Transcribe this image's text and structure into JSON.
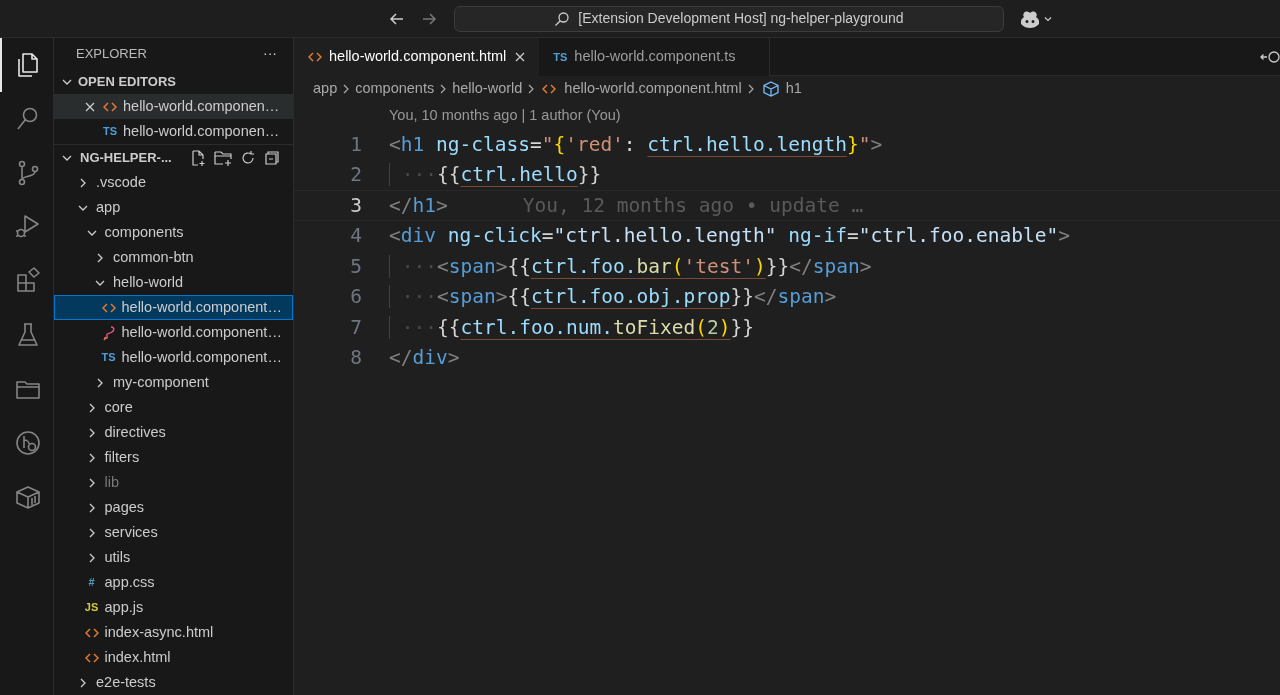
{
  "title_bar": {
    "search_text": "[Extension Development Host] ng-helper-playground"
  },
  "activity_bar": [
    {
      "kind": "files",
      "selected": true
    },
    {
      "kind": "search",
      "selected": false
    },
    {
      "kind": "source-control",
      "selected": false
    },
    {
      "kind": "run-debug",
      "selected": false
    },
    {
      "kind": "extensions",
      "selected": false
    },
    {
      "kind": "testing",
      "selected": false
    },
    {
      "kind": "folder",
      "selected": false
    },
    {
      "kind": "branch-search",
      "selected": false
    },
    {
      "kind": "package",
      "selected": false
    }
  ],
  "sidebar": {
    "title": "EXPLORER",
    "more": "···",
    "open_editors": {
      "title": "OPEN EDITORS",
      "expanded": true,
      "items": [
        {
          "kind": "html",
          "label": "hello-world.componen…",
          "selected": true
        },
        {
          "kind": "ts",
          "badge": "TS",
          "label": "hello-world.componen…",
          "selected": false
        }
      ]
    },
    "project": {
      "title": "NG-HELPER-...",
      "expanded": true,
      "items": [
        {
          "kind": "folder",
          "label": ".vscode",
          "expanded": false,
          "selected": false
        },
        {
          "kind": "folder",
          "label": "app",
          "expanded": true,
          "selected": false,
          "children": [
            {
              "kind": "folder",
              "label": "components",
              "expanded": true,
              "selected": false,
              "children": [
                {
                  "kind": "folder",
                  "label": "common-btn",
                  "expanded": false,
                  "selected": false
                },
                {
                  "kind": "folder",
                  "label": "hello-world",
                  "expanded": true,
                  "selected": false,
                  "children": [
                    {
                      "kind": "html",
                      "label": "hello-world.component…",
                      "selected": true
                    },
                    {
                      "kind": "style",
                      "label": "hello-world.component…",
                      "selected": false
                    },
                    {
                      "kind": "ts",
                      "badge": "TS",
                      "label": "hello-world.component…",
                      "selected": false
                    }
                  ]
                },
                {
                  "kind": "folder",
                  "label": "my-component",
                  "expanded": false,
                  "selected": false
                }
              ]
            },
            {
              "kind": "folder",
              "label": "core",
              "expanded": false,
              "selected": false
            },
            {
              "kind": "folder",
              "label": "directives",
              "expanded": false,
              "selected": false
            },
            {
              "kind": "folder",
              "label": "filters",
              "expanded": false,
              "selected": false
            },
            {
              "kind": "folder",
              "label": "lib",
              "expanded": false,
              "selected": false,
              "dimmed": true
            },
            {
              "kind": "folder",
              "label": "pages",
              "expanded": false,
              "selected": false
            },
            {
              "kind": "folder",
              "label": "services",
              "expanded": false,
              "selected": false
            },
            {
              "kind": "folder",
              "label": "utils",
              "expanded": false,
              "selected": false
            },
            {
              "kind": "css",
              "badge": "#",
              "label": "app.css",
              "selected": false
            },
            {
              "kind": "js",
              "badge": "JS",
              "label": "app.js",
              "selected": false
            },
            {
              "kind": "html",
              "label": "index-async.html",
              "selected": false
            },
            {
              "kind": "html",
              "label": "index.html",
              "selected": false
            }
          ]
        },
        {
          "kind": "folder",
          "label": "e2e-tests",
          "expanded": false,
          "selected": false
        }
      ]
    }
  },
  "tabs": [
    {
      "kind": "html",
      "label": "hello-world.component.html",
      "selected": true
    },
    {
      "kind": "ts",
      "badge": "TS",
      "label": "hello-world.component.ts",
      "selected": false
    }
  ],
  "breadcrumbs": [
    "app",
    "components",
    "hello-world",
    "hello-world.component.html",
    "h1"
  ],
  "codelens": "You, 10 months ago | 1 author (You)",
  "lines": [
    {
      "number": "1",
      "current": false,
      "tokens": [
        {
          "kind": "punct",
          "text": "<"
        },
        {
          "kind": "tag",
          "text": "h1"
        },
        {
          "kind": "attr",
          "text": " ng-class"
        },
        {
          "kind": "plain",
          "text": "="
        },
        {
          "kind": "str",
          "text": "\""
        },
        {
          "kind": "brace",
          "text": "{"
        },
        {
          "kind": "str",
          "text": "'red'"
        },
        {
          "kind": "plain",
          "text": ": "
        },
        {
          "kind": "var",
          "text": "ctrl.hello.length",
          "underline": true
        },
        {
          "kind": "brace",
          "text": "}"
        },
        {
          "kind": "str",
          "text": "\""
        },
        {
          "kind": "punct",
          "text": ">"
        }
      ]
    },
    {
      "number": "2",
      "current": false,
      "tokens": [
        {
          "kind": "ws",
          "text": "···"
        },
        {
          "kind": "plain",
          "text": "{{"
        },
        {
          "kind": "var",
          "text": "ctrl.hello",
          "underline": true
        },
        {
          "kind": "plain",
          "text": "}}"
        }
      ]
    },
    {
      "number": "3",
      "current": true,
      "blame": "You, 12 months ago • update …",
      "tokens": [
        {
          "kind": "punct",
          "text": "</"
        },
        {
          "kind": "tag",
          "text": "h1"
        },
        {
          "kind": "punct",
          "text": ">"
        }
      ]
    },
    {
      "number": "4",
      "current": false,
      "tokens": [
        {
          "kind": "punct",
          "text": "<"
        },
        {
          "kind": "tag",
          "text": "div"
        },
        {
          "kind": "attr",
          "text": " ng-click"
        },
        {
          "kind": "plain",
          "text": "="
        },
        {
          "kind": "value",
          "text": "\"ctrl.hello.length\""
        },
        {
          "kind": "attr",
          "text": " ng-if"
        },
        {
          "kind": "plain",
          "text": "="
        },
        {
          "kind": "value",
          "text": "\"ctrl.foo.enable\""
        },
        {
          "kind": "punct",
          "text": ">"
        }
      ]
    },
    {
      "number": "5",
      "current": false,
      "tokens": [
        {
          "kind": "ws",
          "text": "···"
        },
        {
          "kind": "punct",
          "text": "<"
        },
        {
          "kind": "tag",
          "text": "span"
        },
        {
          "kind": "punct",
          "text": ">"
        },
        {
          "kind": "plain",
          "text": "{{"
        },
        {
          "kind": "var",
          "text": "ctrl.foo.",
          "underline": true
        },
        {
          "kind": "fn",
          "text": "bar",
          "underline": true
        },
        {
          "kind": "brace",
          "text": "(",
          "underline": true
        },
        {
          "kind": "str",
          "text": "'test'",
          "underline": true
        },
        {
          "kind": "brace",
          "text": ")",
          "underline": true
        },
        {
          "kind": "plain",
          "text": "}}"
        },
        {
          "kind": "punct",
          "text": "</"
        },
        {
          "kind": "tag",
          "text": "span"
        },
        {
          "kind": "punct",
          "text": ">"
        }
      ]
    },
    {
      "number": "6",
      "current": false,
      "tokens": [
        {
          "kind": "ws",
          "text": "···"
        },
        {
          "kind": "punct",
          "text": "<"
        },
        {
          "kind": "tag",
          "text": "span"
        },
        {
          "kind": "punct",
          "text": ">"
        },
        {
          "kind": "plain",
          "text": "{{"
        },
        {
          "kind": "var",
          "text": "ctrl.foo.obj.prop",
          "underline": true
        },
        {
          "kind": "plain",
          "text": "}}"
        },
        {
          "kind": "punct",
          "text": "</"
        },
        {
          "kind": "tag",
          "text": "span"
        },
        {
          "kind": "punct",
          "text": ">"
        }
      ]
    },
    {
      "number": "7",
      "current": false,
      "tokens": [
        {
          "kind": "ws",
          "text": "···"
        },
        {
          "kind": "plain",
          "text": "{{"
        },
        {
          "kind": "var",
          "text": "ctrl.foo.num.",
          "underline": true
        },
        {
          "kind": "fn",
          "text": "toFixed",
          "underline": true
        },
        {
          "kind": "brace",
          "text": "(",
          "underline": true
        },
        {
          "kind": "num",
          "text": "2",
          "underline": true
        },
        {
          "kind": "brace",
          "text": ")",
          "underline": true
        },
        {
          "kind": "plain",
          "text": "}}"
        }
      ]
    },
    {
      "number": "8",
      "current": false,
      "tokens": [
        {
          "kind": "punct",
          "text": "</"
        },
        {
          "kind": "tag",
          "text": "div"
        },
        {
          "kind": "punct",
          "text": ">"
        }
      ]
    }
  ]
}
